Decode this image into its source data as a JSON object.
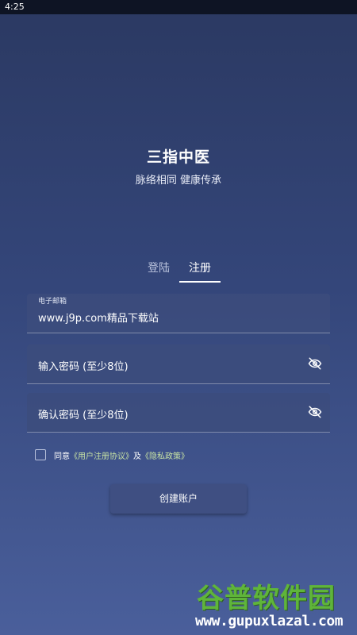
{
  "status_bar": {
    "time": "4:25"
  },
  "brand": {
    "title": "三指中医",
    "subtitle": "脉络相同 健康传承"
  },
  "tabs": [
    {
      "label": "登陆",
      "active": false
    },
    {
      "label": "注册",
      "active": true
    }
  ],
  "form": {
    "email_label": "电子邮箱",
    "email_value": "www.j9p.com精品下载站",
    "password_placeholder": "输入密码 (至少8位)",
    "confirm_placeholder": "确认密码 (至少8位)"
  },
  "agreement": {
    "prefix": "同意",
    "user_agreement": "《用户注册协议》",
    "conjunction": "及",
    "privacy_policy": "《隐私政策》"
  },
  "create_button": "创建账户",
  "watermark": {
    "logo": "谷普软件园",
    "url": "www.gupuxlazal.com"
  },
  "colors": {
    "accent_link": "#c6e1a4",
    "button": "#3f4f82"
  }
}
